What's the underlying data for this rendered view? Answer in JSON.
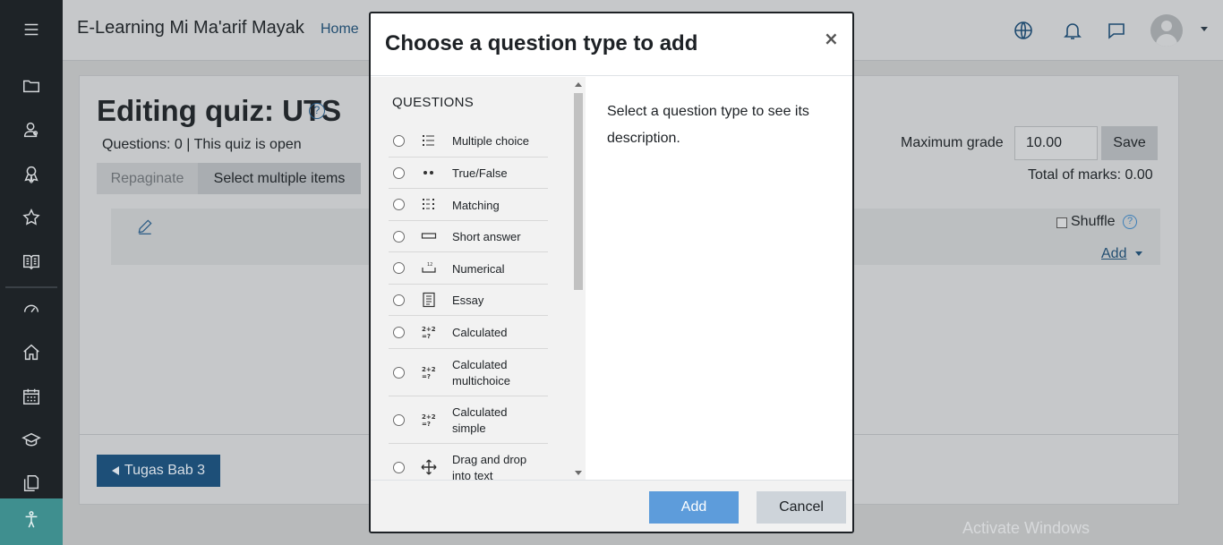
{
  "navbar": {
    "site_name": "E-Learning Mi Ma'arif Mayak",
    "home_link": "Home",
    "icons": [
      "language-icon",
      "notifications-icon",
      "messages-icon",
      "user-avatar"
    ]
  },
  "sidebar": {
    "items": [
      "menu-icon",
      "folder-icon",
      "users-icon",
      "badge-icon",
      "star-icon",
      "book-icon",
      "dashboard-icon",
      "home-icon",
      "calendar-icon",
      "graduation-cap-icon",
      "files-icon",
      "accessibility-icon"
    ]
  },
  "page": {
    "title": "Editing quiz: UTS",
    "info": "Questions: 0 | This quiz is open",
    "repaginate_label": "Repaginate",
    "select_multiple_label": "Select multiple items",
    "max_grade_label": "Maximum grade",
    "max_grade_value": "10.00",
    "save_label": "Save",
    "total_marks": "Total of marks: 0.00",
    "shuffle_label": "Shuffle",
    "add_label": "Add",
    "back_button_label": "Tugas Bab 3"
  },
  "modal": {
    "title": "Choose a question type to add",
    "close_glyph": "×",
    "section_heading": "QUESTIONS",
    "description": "Select a question type to see its description.",
    "add_label": "Add",
    "cancel_label": "Cancel",
    "question_types": [
      {
        "label": "Multiple choice",
        "icon": "multiple-choice-icon"
      },
      {
        "label": "True/False",
        "icon": "true-false-icon"
      },
      {
        "label": "Matching",
        "icon": "matching-icon"
      },
      {
        "label": "Short answer",
        "icon": "short-answer-icon"
      },
      {
        "label": "Numerical",
        "icon": "numerical-icon"
      },
      {
        "label": "Essay",
        "icon": "essay-icon"
      },
      {
        "label": "Calculated",
        "icon": "calculated-icon"
      },
      {
        "label": "Calculated multichoice",
        "icon": "calculated-multichoice-icon"
      },
      {
        "label": "Calculated simple",
        "icon": "calculated-simple-icon"
      },
      {
        "label": "Drag and drop into text",
        "icon": "drag-drop-text-icon"
      }
    ]
  },
  "watermark": "Activate Windows",
  "colors": {
    "sidebar_bg": "#1e2327",
    "accent_blue": "#0f6cbf",
    "add_button": "#5d9cdb",
    "back_button": "#1d4f78"
  }
}
